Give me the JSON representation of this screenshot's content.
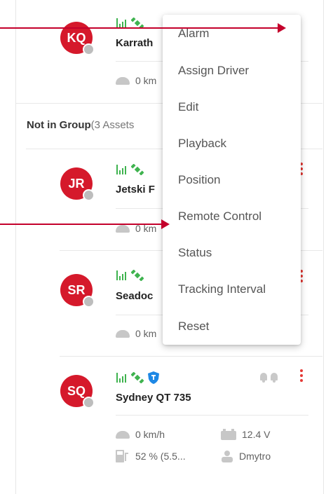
{
  "assets": [
    {
      "initials": "KQ",
      "name": "Karrath",
      "speed": "0 km"
    },
    {
      "initials": "JR",
      "name": "Jetski F",
      "speed": "0 km"
    },
    {
      "initials": "SR",
      "name": "Seadoc",
      "speed": "0 km"
    },
    {
      "initials": "SQ",
      "name": "Sydney QT 735",
      "speed": "0 km/h",
      "voltage": "12.4 V",
      "fuel": "52 % (5.5...",
      "driver": "Dmytro"
    }
  ],
  "group": {
    "label": "Not in Group",
    "count": "(3 Assets"
  },
  "context_menu": {
    "items": [
      "Alarm",
      "Assign Driver",
      "Edit",
      "Playback",
      "Position",
      "Remote Control",
      "Status",
      "Tracking Interval",
      "Reset"
    ]
  },
  "colors": {
    "avatar": "#d5192b",
    "accent": "#e53935",
    "signal": "#3fb34f",
    "shield": "#1e88e5",
    "arrow": "#c4002b"
  }
}
